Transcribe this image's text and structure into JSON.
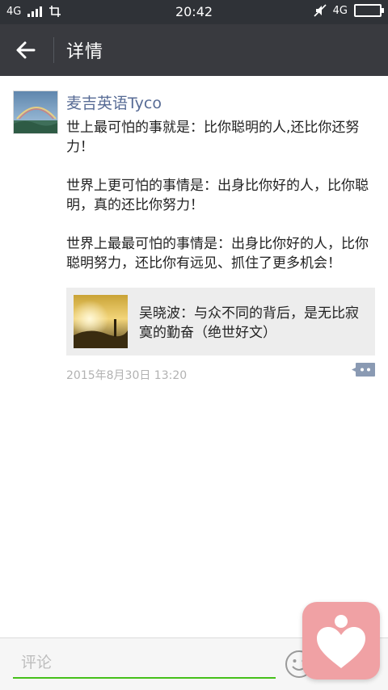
{
  "status_bar": {
    "network": "4G",
    "time": "20:42",
    "right_network": "4G"
  },
  "header": {
    "title": "详情"
  },
  "post": {
    "author": "麦吉英语Tyco",
    "text": "世上最可怕的事就是：比你聪明的人,还比你还努力！\n\n世界上更可怕的事情是：出身比你好的人，比你聪明，真的还比你努力！\n\n世界上最最可怕的事情是：出身比你好的人，比你聪明努力，还比你有远见、抓住了更多机会！",
    "link": {
      "title": "吴晓波：与众不同的背后，是无比寂寞的勤奋（绝世好文）"
    },
    "timestamp": "2015年8月30日 13:20"
  },
  "comment_bar": {
    "placeholder": "评论"
  },
  "colors": {
    "status_bar_bg": "#2f3237",
    "title_bar_bg": "#393a3f",
    "username": "#576b95",
    "input_underline": "#45c01a",
    "floating_button": "#f0a1a4"
  },
  "icons": {
    "back": "back-arrow-icon",
    "comment": "comment-bubble-icon",
    "emoji": "emoji-icon",
    "floating": "heart-person-icon"
  }
}
